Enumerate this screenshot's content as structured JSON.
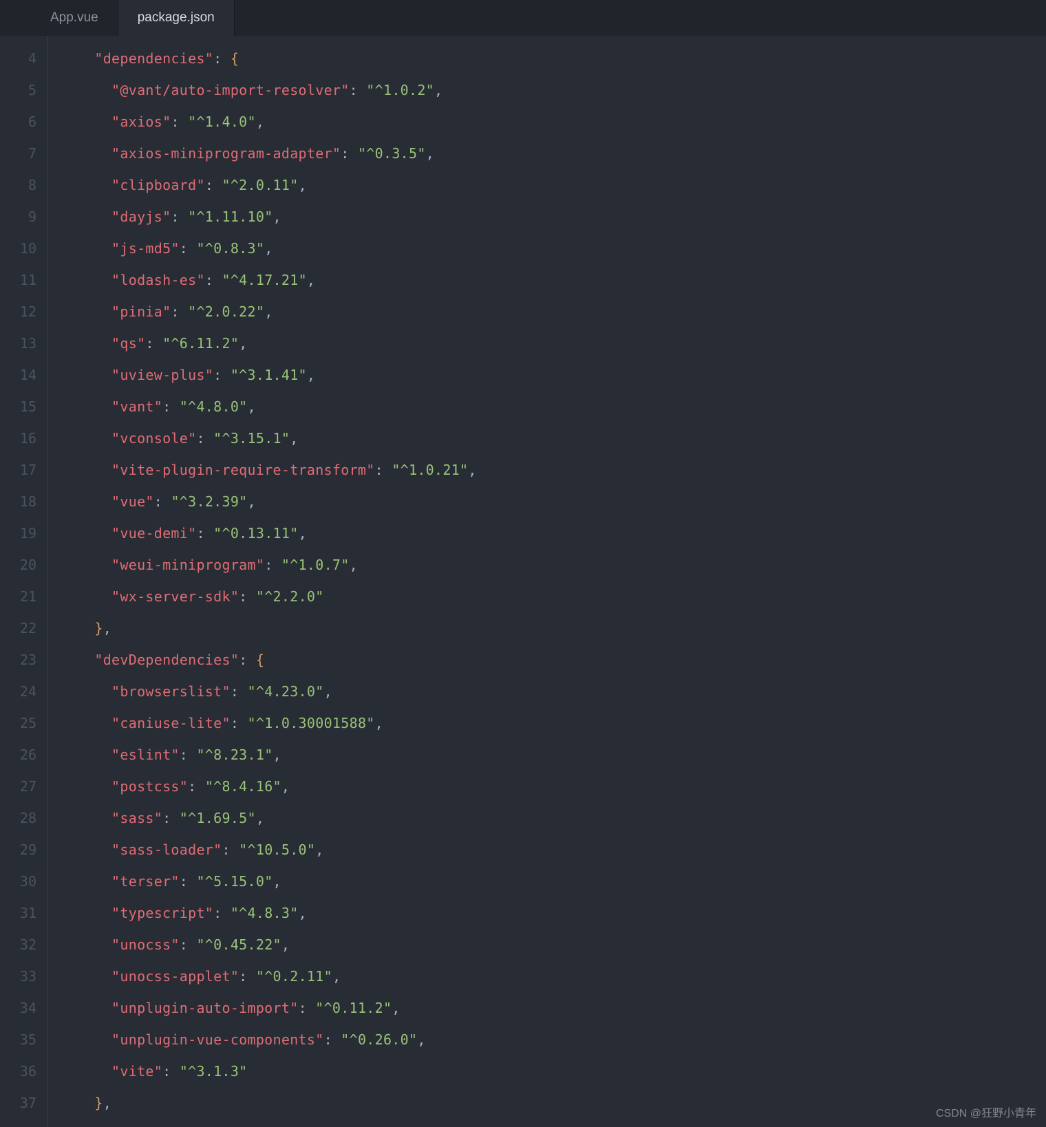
{
  "tabs": [
    {
      "label": "App.vue",
      "active": false
    },
    {
      "label": "package.json",
      "active": true
    }
  ],
  "startLine": 4,
  "code": {
    "dependencies": {
      "@vant/auto-import-resolver": "^1.0.2",
      "axios": "^1.4.0",
      "axios-miniprogram-adapter": "^0.3.5",
      "clipboard": "^2.0.11",
      "dayjs": "^1.11.10",
      "js-md5": "^0.8.3",
      "lodash-es": "^4.17.21",
      "pinia": "^2.0.22",
      "qs": "^6.11.2",
      "uview-plus": "^3.1.41",
      "vant": "^4.8.0",
      "vconsole": "^3.15.1",
      "vite-plugin-require-transform": "^1.0.21",
      "vue": "^3.2.39",
      "vue-demi": "^0.13.11",
      "weui-miniprogram": "^1.0.7",
      "wx-server-sdk": "^2.2.0"
    },
    "devDependencies": {
      "browserslist": "^4.23.0",
      "caniuse-lite": "^1.0.30001588",
      "eslint": "^8.23.1",
      "postcss": "^8.4.16",
      "sass": "^1.69.5",
      "sass-loader": "^10.5.0",
      "terser": "^5.15.0",
      "typescript": "^4.8.3",
      "unocss": "^0.45.22",
      "unocss-applet": "^0.2.11",
      "unplugin-auto-import": "^0.11.2",
      "unplugin-vue-components": "^0.26.0",
      "vite": "^3.1.3"
    }
  },
  "watermark": "CSDN @狂野小青年"
}
